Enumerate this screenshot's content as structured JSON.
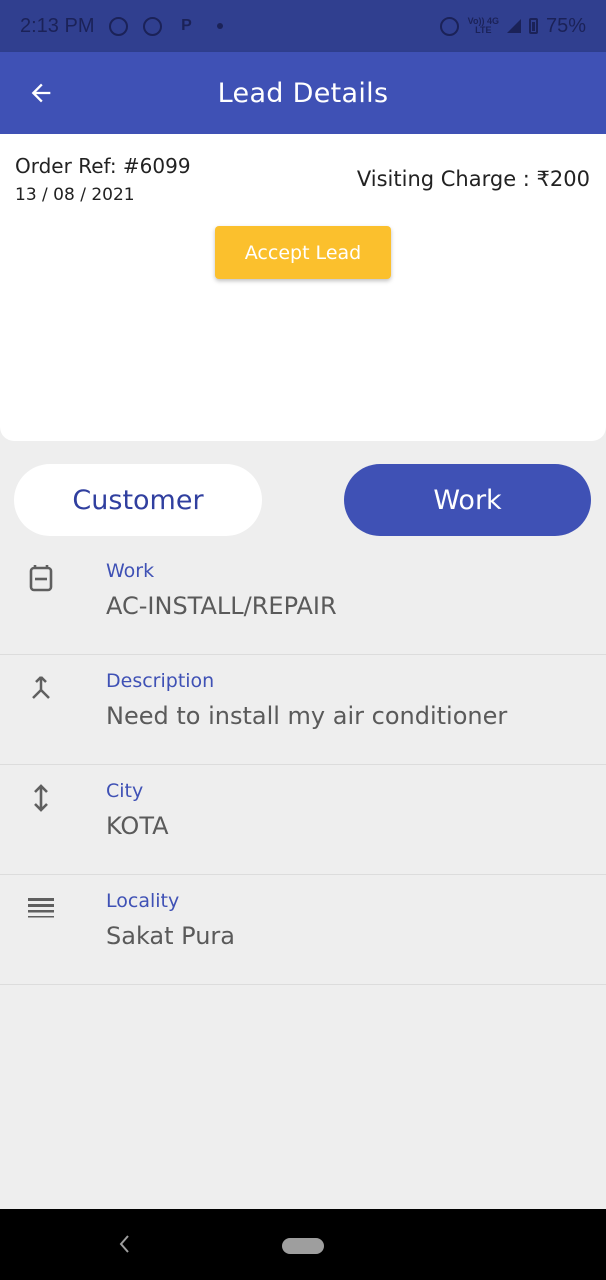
{
  "status_bar": {
    "time": "2:13 PM",
    "notification_icons": [
      "messenger-icon",
      "whatsapp-icon",
      "paytm-icon",
      "dot-icon"
    ],
    "network_label_top": "Vo)) 4G",
    "network_label_bottom": "LTE",
    "battery": "75%"
  },
  "app_bar": {
    "title": "Lead Details",
    "back_icon": "arrow-left-icon"
  },
  "lead": {
    "order_ref": "Order Ref: #6099",
    "date": "13 / 08 / 2021",
    "visiting_charge": "Visiting Charge : ₹200",
    "accept_label": "Accept Lead",
    "accent_color": "#fbc02d"
  },
  "tabs": {
    "customer": "Customer",
    "work": "Work",
    "active": "work",
    "active_color": "#3f51b5"
  },
  "details": [
    {
      "icon": "ac-unit-icon",
      "label": "Work",
      "value": "AC-INSTALL/REPAIR"
    },
    {
      "icon": "merge-icon",
      "label": "Description",
      "value": "Need to install my air conditioner"
    },
    {
      "icon": "vertical-arrows-icon",
      "label": "City",
      "value": "KOTA"
    },
    {
      "icon": "list-lines-icon",
      "label": "Locality",
      "value": "Sakat Pura"
    }
  ],
  "nav_bar": {
    "back_icon": "chevron-left-icon",
    "home_icon": "home-pill-icon"
  }
}
